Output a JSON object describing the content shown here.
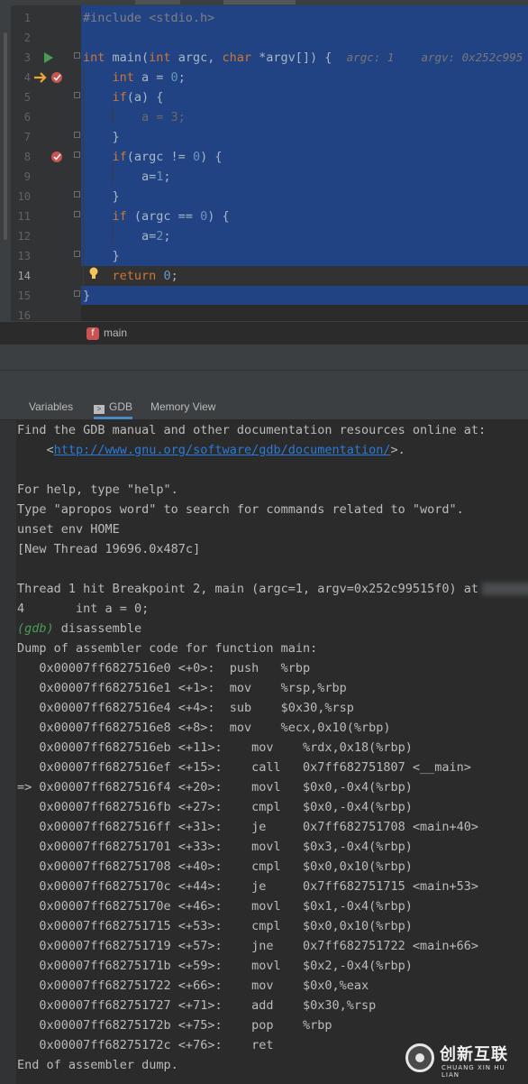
{
  "editor": {
    "lines": [
      {
        "n": "1",
        "html": "<span class='cm'>#include &lt;stdio.h&gt;</span>"
      },
      {
        "n": "2",
        "html": ""
      },
      {
        "n": "3",
        "html": "<span class='kw'>int</span> main(<span class='kw'>int</span> argc, <span class='kw'>char</span> *argv[]) {  <span class='hint'>argc: 1    argv: 0x252c995</span>"
      },
      {
        "n": "4",
        "html": "    <span class='kw'>int</span> a = <span class='num'>0</span>;"
      },
      {
        "n": "5",
        "html": "    <span class='kw'>if</span>(a) {"
      },
      {
        "n": "6",
        "html": "        <span class='gray'>a = 3;</span>"
      },
      {
        "n": "7",
        "html": "    }"
      },
      {
        "n": "8",
        "html": "    <span class='kw'>if</span>(argc != <span class='num'>0</span>) {"
      },
      {
        "n": "9",
        "html": "        a=<span class='num'>1</span>;"
      },
      {
        "n": "10",
        "html": "    }"
      },
      {
        "n": "11",
        "html": "    <span class='kw'>if</span> (argc == <span class='num'>0</span>) {"
      },
      {
        "n": "12",
        "html": "        a=<span class='num'>2</span>;"
      },
      {
        "n": "13",
        "html": "    }"
      },
      {
        "n": "14",
        "html": "    <span class='kw'>return</span> <span class='num'>0</span>;"
      },
      {
        "n": "15",
        "html": "}"
      },
      {
        "n": "16",
        "html": ""
      }
    ],
    "current_line": "14",
    "breadcrumb_badge": "f",
    "breadcrumb": "main"
  },
  "tool_tabs": {
    "variables": "Variables",
    "gdb": "GDB",
    "memory": "Memory View"
  },
  "console": {
    "lines": [
      "Find the GDB manual and other documentation resources online at:",
      "    <<a class='link'>http://www.gnu.org/software/gdb/documentation/</a>>.",
      "",
      "For help, type \"help\".",
      "Type \"apropos word\" to search for commands related to \"word\".",
      "unset env HOME",
      "[New Thread 19696.0x487c]",
      "",
      "Thread 1 hit Breakpoint 2, main (argc=1, argv=0x252c99515f0) at<span class='blur'></span>",
      "4       int a = 0;",
      "<span class='prompt'>(gdb)</span> disassemble",
      "Dump of assembler code for function main:",
      "   0x00007ff6827516e0 <+0>:  push   %rbp",
      "   0x00007ff6827516e1 <+1>:  mov    %rsp,%rbp",
      "   0x00007ff6827516e4 <+4>:  sub    $0x30,%rsp",
      "   0x00007ff6827516e8 <+8>:  mov    %ecx,0x10(%rbp)",
      "   0x00007ff6827516eb <+11>:    mov    %rdx,0x18(%rbp)",
      "   0x00007ff6827516ef <+15>:    call   0x7ff682751807 <__main>",
      "=> 0x00007ff6827516f4 <+20>:    movl   $0x0,-0x4(%rbp)",
      "   0x00007ff6827516fb <+27>:    cmpl   $0x0,-0x4(%rbp)",
      "   0x00007ff6827516ff <+31>:    je     0x7ff682751708 <main+40>",
      "   0x00007ff682751701 <+33>:    movl   $0x3,-0x4(%rbp)",
      "   0x00007ff682751708 <+40>:    cmpl   $0x0,0x10(%rbp)",
      "   0x00007ff68275170c <+44>:    je     0x7ff682751715 <main+53>",
      "   0x00007ff68275170e <+46>:    movl   $0x1,-0x4(%rbp)",
      "   0x00007ff682751715 <+53>:    cmpl   $0x0,0x10(%rbp)",
      "   0x00007ff682751719 <+57>:    jne    0x7ff682751722 <main+66>",
      "   0x00007ff68275171b <+59>:    movl   $0x2,-0x4(%rbp)",
      "   0x00007ff682751722 <+66>:    mov    $0x0,%eax",
      "   0x00007ff682751727 <+71>:    add    $0x30,%rsp",
      "   0x00007ff68275172b <+75>:    pop    %rbp",
      "   0x00007ff68275172c <+76>:    ret",
      "End of assembler dump."
    ]
  },
  "watermark": {
    "text": "创新互联",
    "sub": "CHUANG XIN HU LIAN"
  }
}
